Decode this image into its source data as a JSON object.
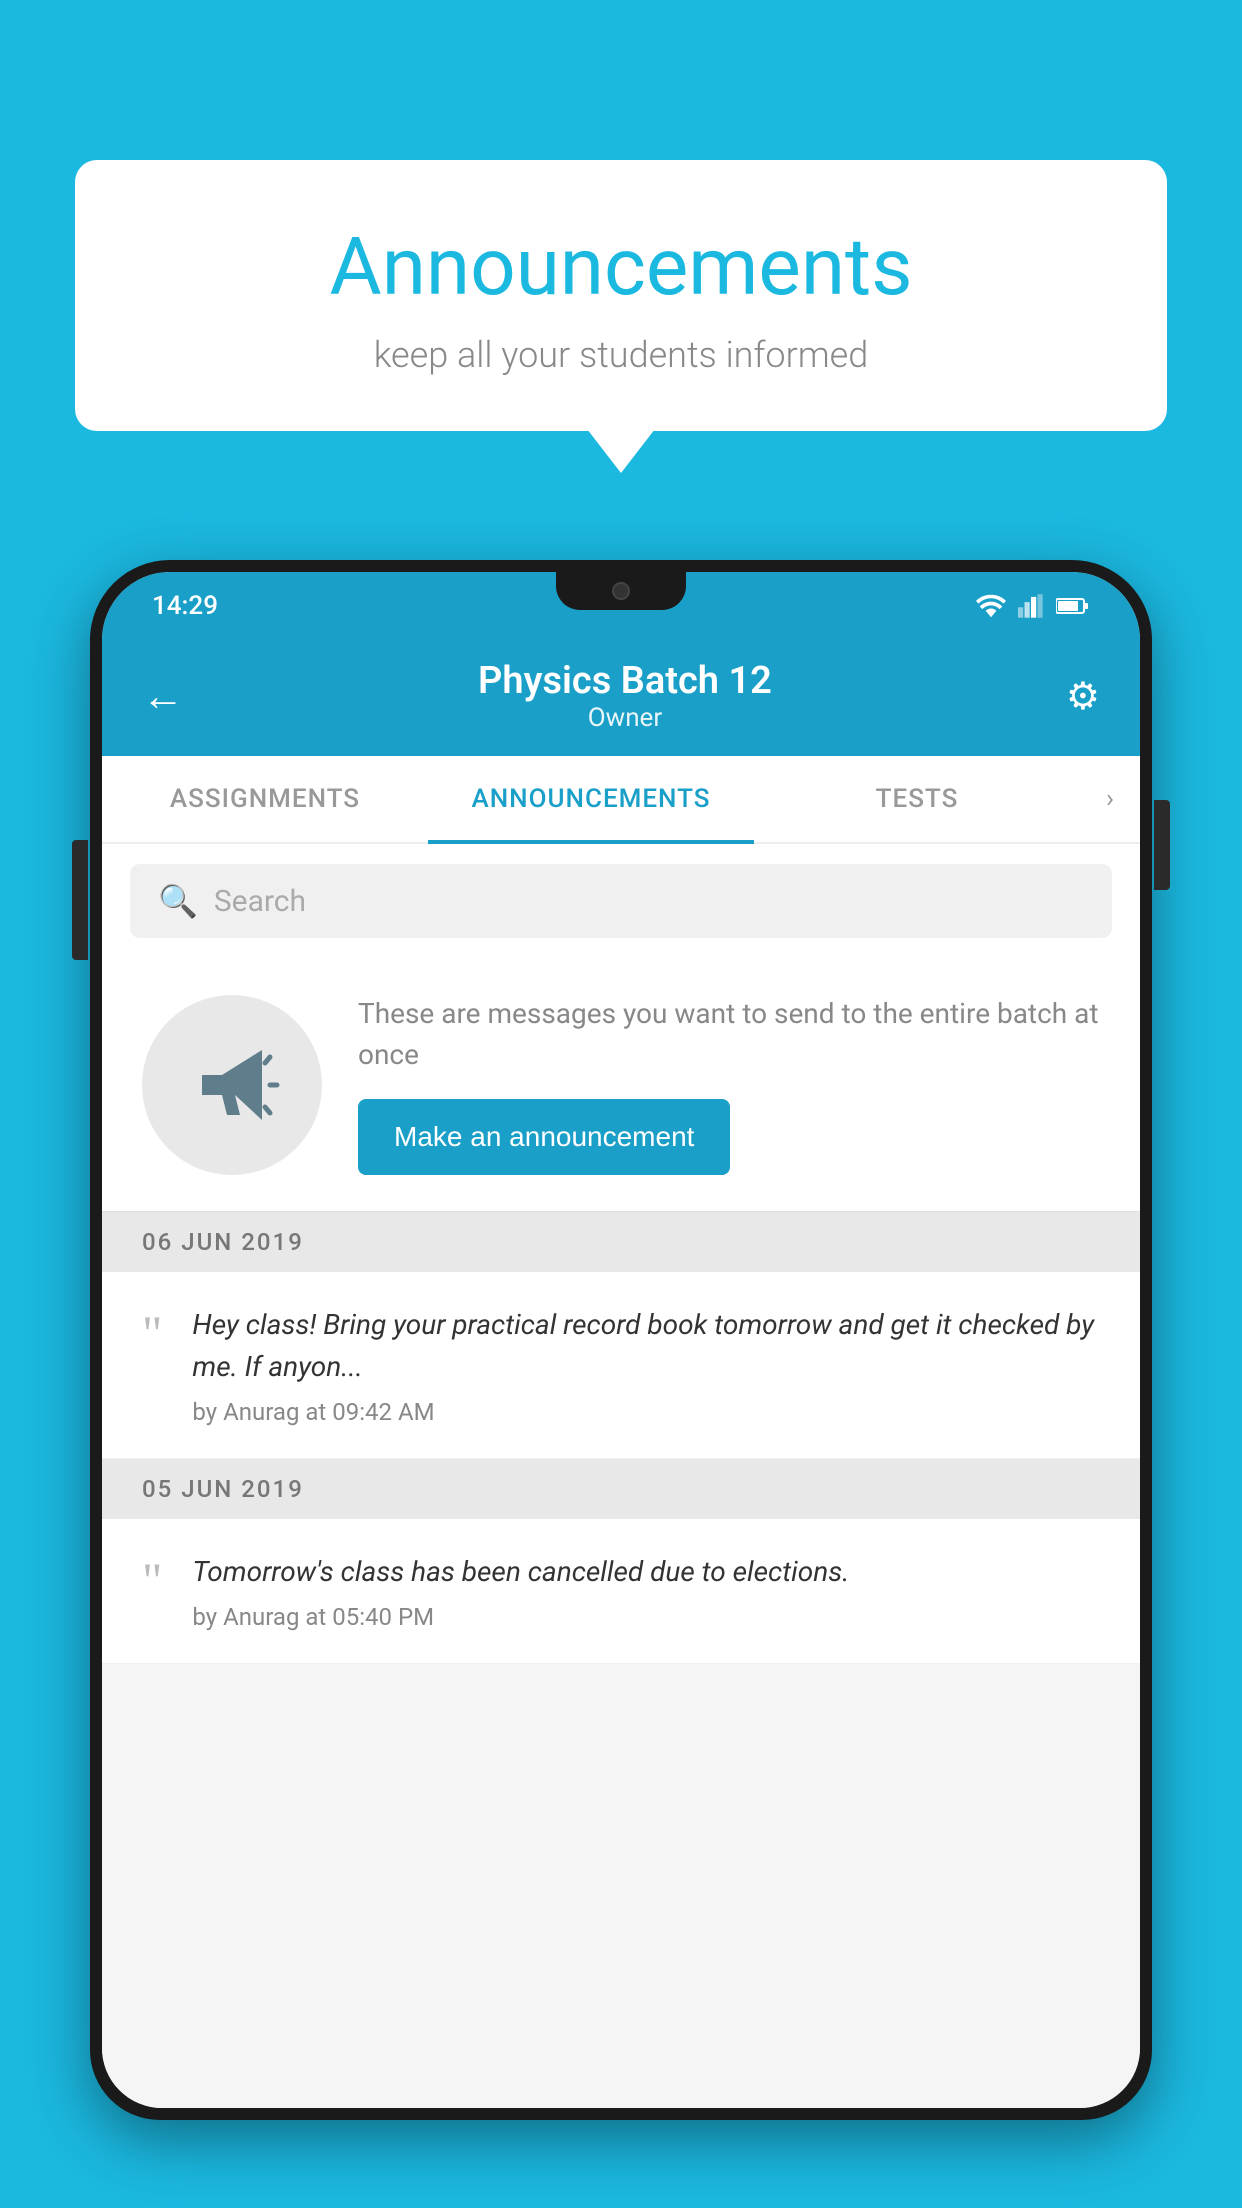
{
  "background_color": "#1bb8e0",
  "speech_bubble": {
    "title": "Announcements",
    "subtitle": "keep all your students informed"
  },
  "phone": {
    "status_bar": {
      "time": "14:29"
    },
    "app_bar": {
      "title": "Physics Batch 12",
      "subtitle": "Owner",
      "back_label": "←",
      "settings_label": "⚙"
    },
    "tabs": [
      {
        "label": "ASSIGNMENTS",
        "active": false
      },
      {
        "label": "ANNOUNCEMENTS",
        "active": true
      },
      {
        "label": "TESTS",
        "active": false
      }
    ],
    "search": {
      "placeholder": "Search"
    },
    "promo": {
      "description_text": "These are messages you want to send to the entire batch at once",
      "cta_label": "Make an announcement"
    },
    "announcements": [
      {
        "date": "06  JUN  2019",
        "items": [
          {
            "text": "Hey class! Bring your practical record book tomorrow and get it checked by me. If anyon...",
            "meta": "by Anurag at 09:42 AM"
          }
        ]
      },
      {
        "date": "05  JUN  2019",
        "items": [
          {
            "text": "Tomorrow's class has been cancelled due to elections.",
            "meta": "by Anurag at 05:40 PM"
          }
        ]
      }
    ]
  }
}
